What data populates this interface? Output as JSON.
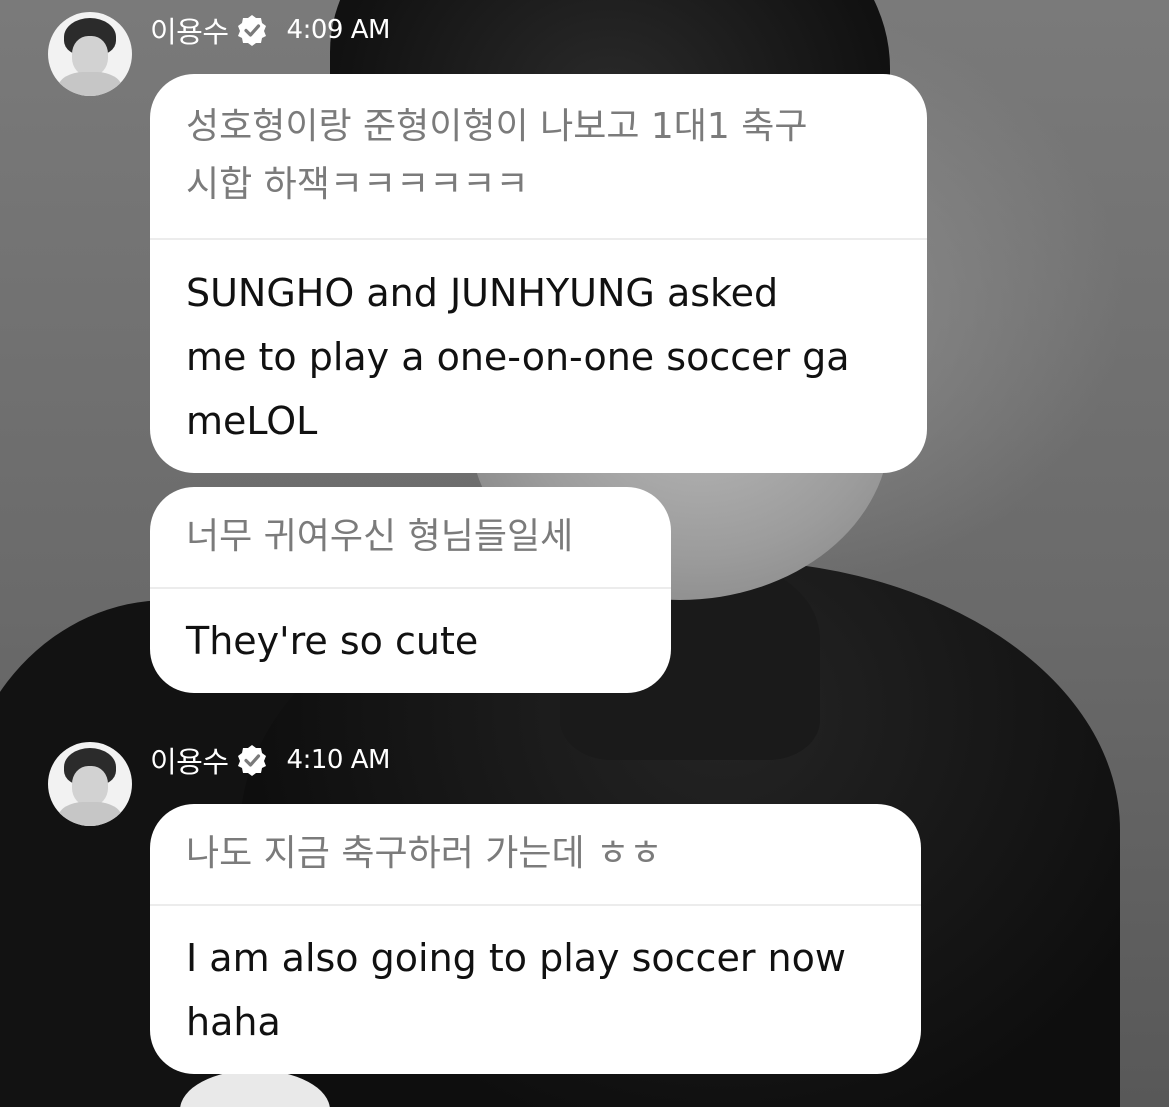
{
  "messages": [
    {
      "sender": "이용수",
      "time": "4:09 AM",
      "bubbles": [
        {
          "original_lines": [
            "성호형이랑 준형이형이 나보고 1대1 축구",
            " 시합 하잭ㅋㅋㅋㅋㅋㅋ"
          ],
          "translation_lines": [
            "SUNGHO and JUNHYUNG asked",
            "me to play a one-on-one soccer ga",
            "meLOL"
          ]
        },
        {
          "original_lines": [
            "너무 귀여우신 형님들일세"
          ],
          "translation_lines": [
            "They're so cute"
          ]
        }
      ]
    },
    {
      "sender": "이용수",
      "time": "4:10 AM",
      "bubbles": [
        {
          "original_lines": [
            "나도 지금 축구하러 가는데 ㅎㅎ"
          ],
          "translation_lines": [
            "I am also going to play soccer now",
            "haha"
          ]
        }
      ]
    }
  ],
  "icons": {
    "verified": "verified-badge-icon"
  },
  "colors": {
    "bubble_bg": "#ffffff",
    "original_text": "#7b7b7b",
    "translation_text": "#111111",
    "header_text": "#ffffff"
  }
}
